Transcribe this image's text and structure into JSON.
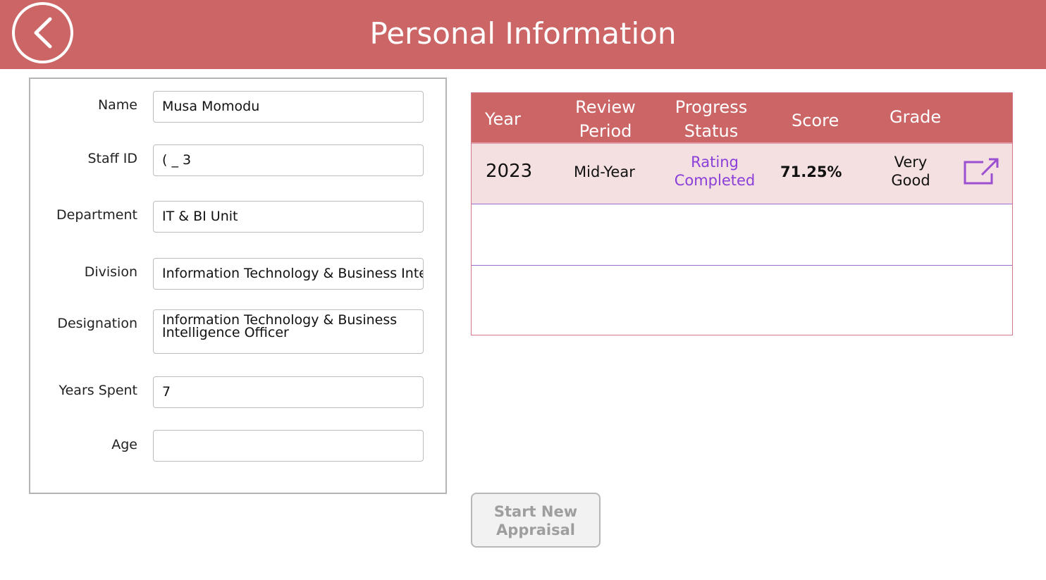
{
  "header": {
    "title": "Personal Information",
    "back_icon": "chevron-left-icon"
  },
  "form": {
    "fields": [
      {
        "label": "Name",
        "value": "Musa Momodu"
      },
      {
        "label": "Staff ID",
        "value": "( _ 3"
      },
      {
        "label": "Department",
        "value": "IT & BI Unit"
      },
      {
        "label": "Division",
        "value": "Information Technology & Business Intelligence"
      },
      {
        "label": "Designation",
        "value": "Information Technology & Business Intelligence Officer"
      },
      {
        "label": "Years Spent",
        "value": "7"
      },
      {
        "label": "Age",
        "value": ""
      }
    ]
  },
  "appraisals": {
    "columns": [
      "Year",
      "Review Period",
      "Progress Status",
      "Score",
      "Grade"
    ],
    "columns_wrapped": {
      "review_period": [
        "Review",
        "Period"
      ],
      "progress_status": [
        "Progress",
        "Status"
      ]
    },
    "rows": [
      {
        "year": "2023",
        "review_period": "Mid-Year",
        "progress_status": [
          "Rating",
          "Completed"
        ],
        "score": "71.25%",
        "grade": [
          "Very",
          "Good"
        ],
        "action_icon": "open-external-icon"
      }
    ]
  },
  "actions": {
    "start_new_line1": "Start New",
    "start_new_line2": "Appraisal"
  },
  "colors": {
    "header_bg": "#cb6566",
    "row_highlight": "#f4dfe1",
    "status_text": "#8a3fd8",
    "icon": "#9b4fd1"
  }
}
